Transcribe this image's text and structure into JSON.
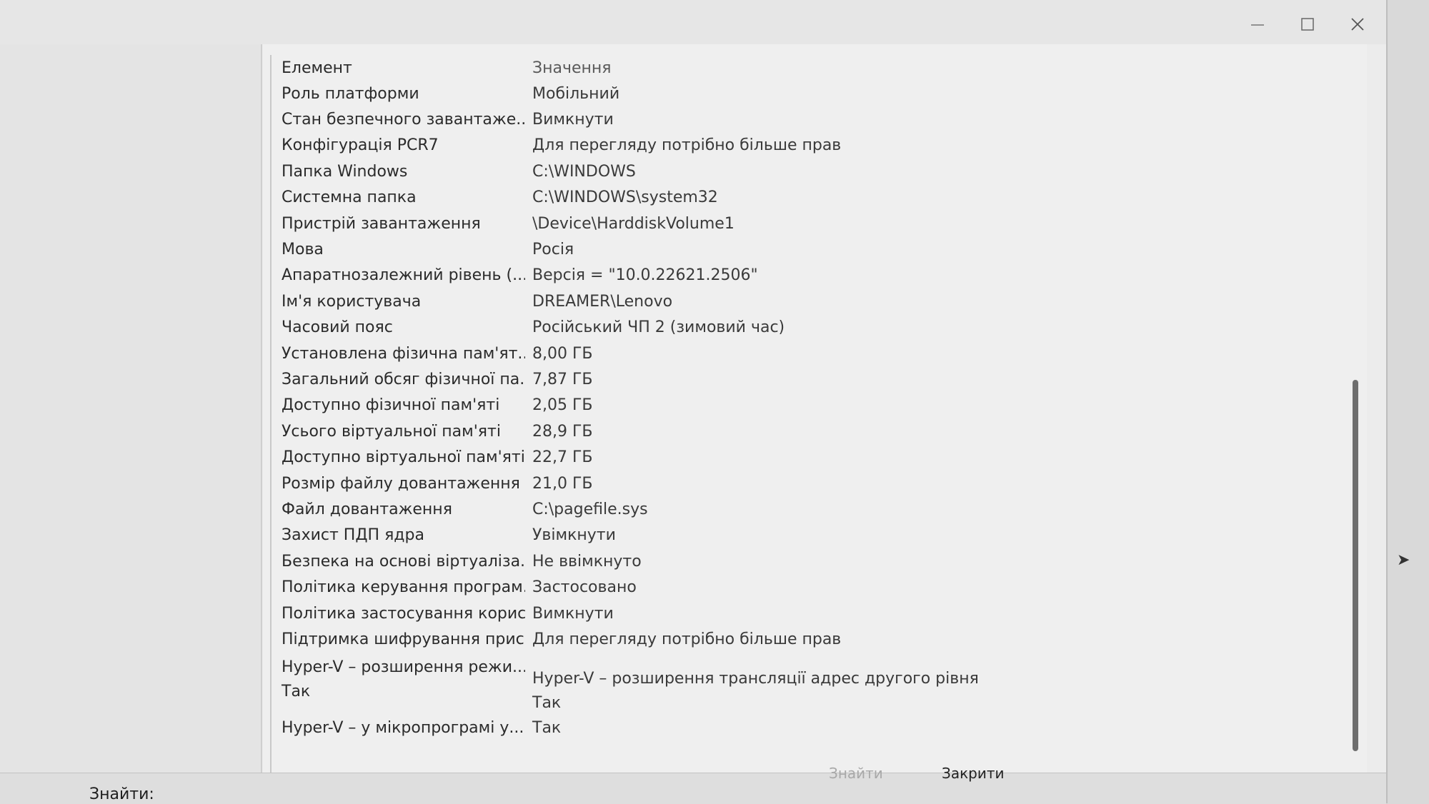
{
  "header": {
    "element": "Елемент",
    "value": "Значення"
  },
  "rows": [
    {
      "element": "Роль платформи",
      "value": "Мобільний"
    },
    {
      "element": "Стан безпечного завантаже...",
      "value": "Вимкнути"
    },
    {
      "element": "Конфігурація PCR7",
      "value": "Для перегляду потрібно більше прав"
    },
    {
      "element": "Папка Windows",
      "value": "C:\\WINDOWS"
    },
    {
      "element": "Системна папка",
      "value": "C:\\WINDOWS\\system32"
    },
    {
      "element": "Пристрій завантаження",
      "value": "\\Device\\HarddiskVolume1"
    },
    {
      "element": "Мова",
      "value": "Росія"
    },
    {
      "element": "Апаратнозалежний рівень (...",
      "value": "Версія = \"10.0.22621.2506\""
    },
    {
      "element": "Ім'я користувача",
      "value": "DREAMER\\Lenovo"
    },
    {
      "element": "Часовий пояс",
      "value": "Російський ЧП 2 (зимовий час)"
    },
    {
      "element": "Установлена фізична пам'ят...",
      "value": "8,00 ГБ"
    },
    {
      "element": "Загальний обсяг фізичної па...",
      "value": "7,87 ГБ"
    },
    {
      "element": "Доступно фізичної пам'яті",
      "value": "2,05 ГБ"
    },
    {
      "element": "Усього віртуальної пам'яті",
      "value": "28,9 ГБ"
    },
    {
      "element": "Доступно віртуальної пам'яті",
      "value": "22,7 ГБ"
    },
    {
      "element": "Розмір файлу довантаження",
      "value": "21,0 ГБ"
    },
    {
      "element": "Файл довантаження",
      "value": "C:\\pagefile.sys"
    },
    {
      "element": "Захист ПДП ядра",
      "value": "Увімкнути"
    },
    {
      "element": "Безпека на основі віртуаліза...",
      "value": "Не ввімкнуто"
    },
    {
      "element": "Політика керування програм...",
      "value": "Застосовано"
    },
    {
      "element": "Політика застосування корис...",
      "value": "Вимкнути"
    },
    {
      "element": "Підтримка шифрування прис...",
      "value": "Для перегляду потрібно більше прав"
    }
  ],
  "hyperv": {
    "element1": "Hyper-V – розширення режи...",
    "element2": "Так",
    "value1": "Hyper-V – розширення трансляції адрес другого рівня",
    "value2": "Так",
    "last_element": "Hyper-V – у мікропрограмі у...",
    "last_value": "Так"
  },
  "footer": {
    "find_label": "Знайти:",
    "find_button": "Знайти",
    "close_button": "Закрити"
  },
  "window_controls": {
    "minimize_icon": "minimize-icon",
    "maximize_icon": "maximize-icon",
    "close_icon": "close-icon"
  }
}
